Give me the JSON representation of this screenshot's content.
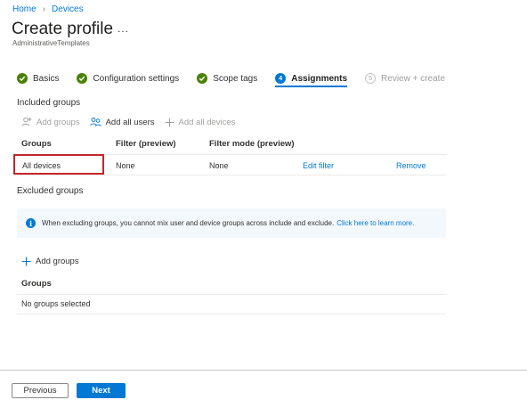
{
  "breadcrumb": {
    "home": "Home",
    "devices": "Devices"
  },
  "header": {
    "title": "Create profile",
    "more": "...",
    "subtitle": "AdministrativeTemplates"
  },
  "steps": [
    {
      "label": "Basics",
      "state": "done"
    },
    {
      "label": "Configuration settings",
      "state": "done"
    },
    {
      "label": "Scope tags",
      "state": "done"
    },
    {
      "label": "Assignments",
      "state": "current",
      "number": "4"
    },
    {
      "label": "Review + create",
      "state": "pending",
      "number": "5"
    }
  ],
  "included": {
    "label": "Included groups",
    "toolbar": {
      "add_groups": "Add groups",
      "add_all_users": "Add all users",
      "add_all_devices": "Add all devices"
    },
    "columns": [
      "Groups",
      "Filter (preview)",
      "Filter mode (preview)"
    ],
    "rows": [
      {
        "group": "All devices",
        "filter": "None",
        "filter_mode": "None",
        "edit": "Edit filter",
        "remove": "Remove"
      }
    ]
  },
  "excluded": {
    "label": "Excluded groups",
    "info_text": "When excluding groups, you cannot mix user and device groups across include and exclude.",
    "info_link": "Click here to learn more.",
    "add_groups": "Add groups",
    "column": "Groups",
    "empty": "No groups selected"
  },
  "footer": {
    "previous": "Previous",
    "next": "Next"
  },
  "colors": {
    "accent": "#0078d4",
    "success": "#498205",
    "highlight": "#c4262e"
  }
}
